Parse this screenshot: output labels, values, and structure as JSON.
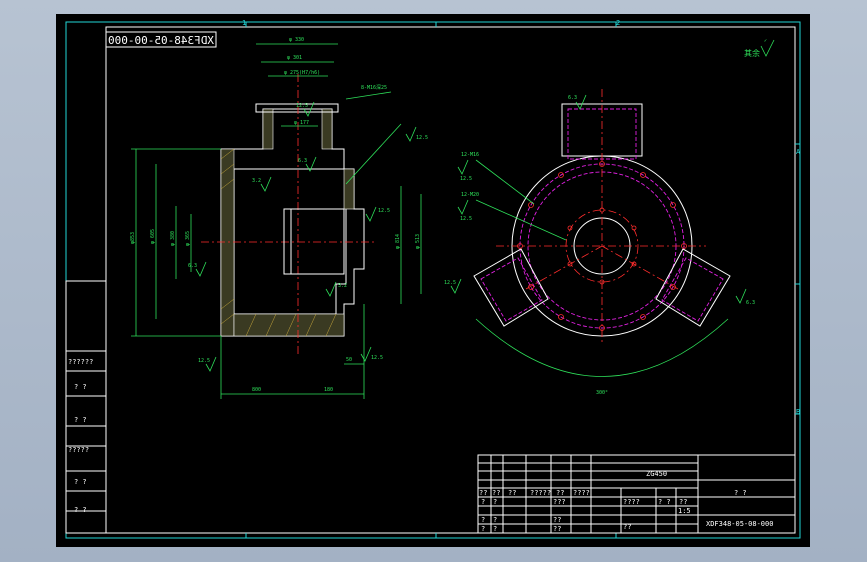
{
  "drawing": {
    "code_mirrored": "XDF348-05-00-000",
    "material": "ZG450",
    "drawing_no": "XDF348-05-08-000",
    "part_name": "? ?",
    "note_text": "其余",
    "scale": "1:5"
  },
  "frame": {
    "top_zones": [
      "1",
      "2"
    ],
    "right_zones": [
      "A",
      "B"
    ],
    "left_block": [
      "??????",
      "? ?",
      "? ?",
      "?????",
      "? ?",
      "? ?"
    ]
  },
  "front_view": {
    "dims_top": [
      "φ 330",
      "φ 301",
      "φ 275(H7/h6)",
      "φ 177"
    ],
    "dims_left": [
      "φ853",
      "φ 605",
      "φ 380",
      "φ 365"
    ],
    "dims_right": [
      "φ 814",
      "φ 513"
    ],
    "dims_bottom": [
      "800",
      "180",
      "50"
    ],
    "callout_a": "8-M16深25",
    "roughness": [
      "12.5",
      "3.2",
      "6.3",
      "12.5",
      "3.2",
      "6.3",
      "12.5",
      "12.5",
      "12.5"
    ]
  },
  "side_view": {
    "callouts": [
      "12-M16",
      "12-M20"
    ],
    "roughness": [
      "6.3",
      "12.5",
      "12.5",
      "12.5",
      "6.3"
    ],
    "arc_dim": "300°"
  },
  "title_block": {
    "headers": [
      "??",
      "??",
      "??",
      "?????",
      "??",
      "????"
    ],
    "rows": [
      [
        "?",
        "?",
        "???"
      ],
      [
        "?",
        "?",
        "??"
      ],
      [
        "?",
        "?",
        "??"
      ]
    ],
    "stage_labels": [
      "????",
      "? ?",
      "??",
      "??"
    ]
  }
}
